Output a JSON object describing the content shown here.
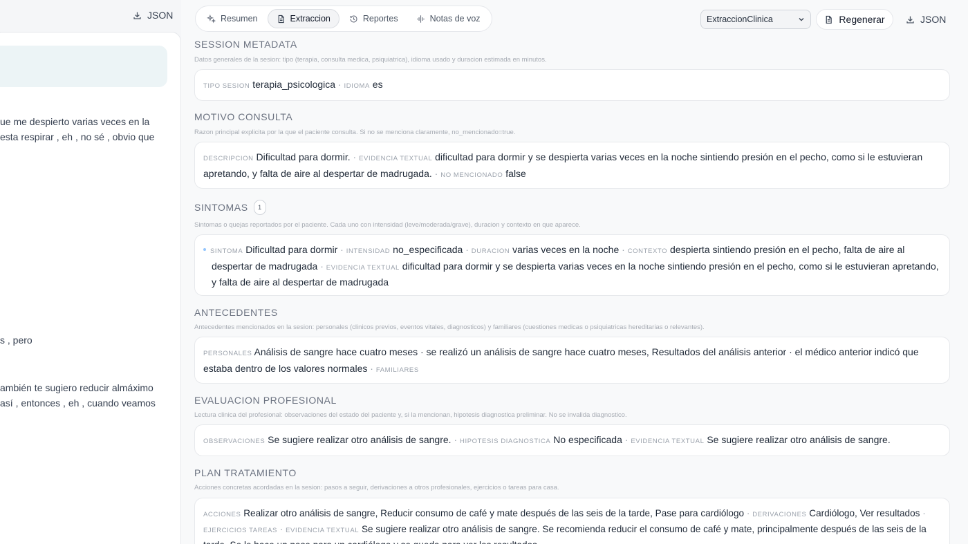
{
  "left": {
    "json_label": "JSON",
    "lines": [
      "ue me despierto varias veces en la",
      "esta respirar , eh , no sé , obvio que",
      "s , pero",
      "ambién te sugiero reducir almáximo",
      "así , entonces , eh , cuando veamos"
    ]
  },
  "tabs": [
    {
      "label": "Resumen",
      "icon": "sparkles-icon"
    },
    {
      "label": "Extraccion",
      "icon": "document-icon",
      "active": true
    },
    {
      "label": "Reportes",
      "icon": "history-icon"
    },
    {
      "label": "Notas de voz",
      "icon": "voice-icon"
    }
  ],
  "toolbar": {
    "select_value": "ExtraccionClinica",
    "regen_label": "Regenerar",
    "json_label": "JSON"
  },
  "sections": {
    "session": {
      "title": "SESSION METADATA",
      "desc": "Datos generales de la sesion: tipo (terapia, consulta medica, psiquiatrica), idioma usado y duracion estimada en minutos.",
      "l1": "tipo sesion",
      "v1": "terapia_psicologica",
      "l2": "idioma",
      "v2": "es"
    },
    "motivo": {
      "title": "MOTIVO CONSULTA",
      "desc": "Razon principal explicita por la que el paciente consulta. Si no se menciona claramente, no_mencionado=true.",
      "l1": "descripcion",
      "v1": "Dificultad para dormir.",
      "l2": "evidencia textual",
      "v2": "dificultad para dormir y se despierta varias veces en la noche sintiendo presión en el pecho, como si le estuvieran apretando, y falta de aire al despertar de madrugada.",
      "l3": "no mencionado",
      "v3": "false"
    },
    "sintomas": {
      "title": "SINTOMAS",
      "count": "1",
      "desc": "Sintomas o quejas reportados por el paciente. Cada uno con intensidad (leve/moderada/grave), duracion y contexto en que aparece.",
      "l1": "sintoma",
      "v1": "Dificultad para dormir",
      "l2": "intensidad",
      "v2": "no_especificada",
      "l3": "duracion",
      "v3": "varias veces en la noche",
      "l4": "contexto",
      "v4": "despierta sintiendo presión en el pecho, falta de aire al despertar de madrugada",
      "l5": "evidencia textual",
      "v5": "dificultad para dormir y se despierta varias veces en la noche sintiendo presión en el pecho, como si le estuvieran apretando, y falta de aire al despertar de madrugada"
    },
    "antecedentes": {
      "title": "ANTECEDENTES",
      "desc": "Antecedentes mencionados en la sesion: personales (clinicos previos, eventos vitales, diagnosticos) y familiares (cuestiones medicas o psiquiatricas hereditarias o relevantes).",
      "l1": "personales",
      "v1": "Análisis de sangre hace cuatro meses · se realizó un análisis de sangre hace cuatro meses, Resultados del análisis anterior · el médico anterior indicó que estaba dentro de los valores normales",
      "l2": "familiares"
    },
    "evaluacion": {
      "title": "EVALUACION PROFESIONAL",
      "desc": "Lectura clinica del profesional: observaciones del estado del paciente y, si la mencionan, hipotesis diagnostica preliminar. No se invalida diagnostico.",
      "l1": "observaciones",
      "v1": "Se sugiere realizar otro análisis de sangre.",
      "l2": "hipotesis diagnostica",
      "v2": "No especificada",
      "l3": "evidencia textual",
      "v3": "Se sugiere realizar otro análisis de sangre."
    },
    "plan": {
      "title": "PLAN TRATAMIENTO",
      "desc": "Acciones concretas acordadas en la sesion: pasos a seguir, derivaciones a otros profesionales, ejercicios o tareas para casa.",
      "l1": "acciones",
      "v1": "Realizar otro análisis de sangre, Reducir consumo de café y mate después de las seis de la tarde, Pase para cardiólogo",
      "l2": "derivaciones",
      "v2": "Cardiólogo, Ver resultados",
      "l3": "ejercicios tareas",
      "l4": "evidencia textual",
      "v4": "Se sugiere realizar otro análisis de sangre. Se recomienda reducir el consumo de café y mate, principalmente después de las seis de la tarde. Se le hace un pase para un cardiólogo y se queda para ver los resultados."
    }
  },
  "separator": "·"
}
